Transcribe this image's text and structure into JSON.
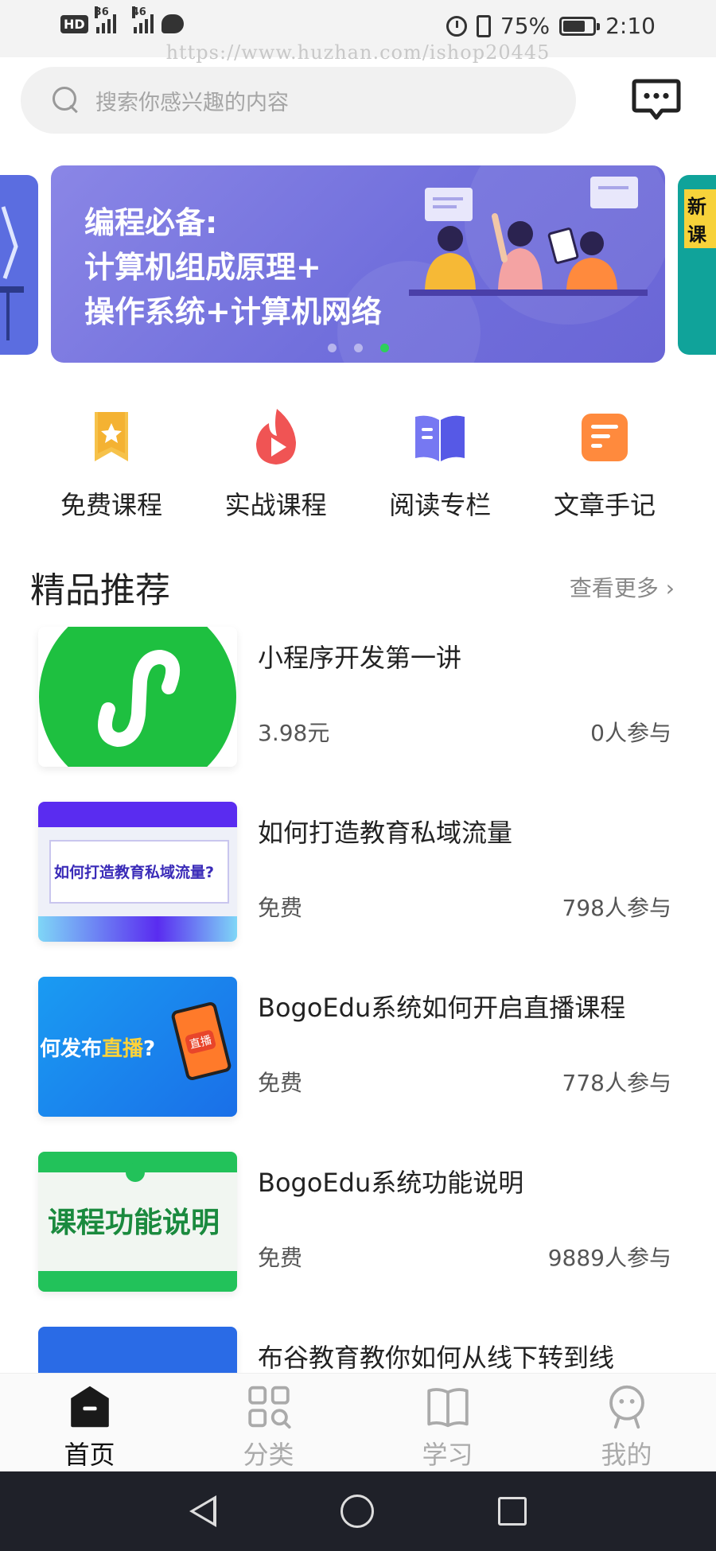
{
  "status_bar": {
    "hd_label": "HD",
    "sim1_label": "36",
    "sim2_label": "46",
    "battery": "75%",
    "battery_level": 0.75,
    "time": "2:10"
  },
  "watermark": "https://www.huzhan.com/ishop20445",
  "search": {
    "placeholder": "搜索你感兴趣的内容",
    "icon": "search-icon"
  },
  "header": {
    "message_icon": "chat-message-icon"
  },
  "banner": {
    "lines": [
      "编程必备:",
      "计算机组成原理+",
      "操作系统+计算机网络"
    ],
    "right_peek_text": "新课",
    "page_count": 3,
    "active_index": 2,
    "colors": {
      "bg": "#7a77e0",
      "active_dot": "#2ecf5a"
    }
  },
  "quick_nav": [
    {
      "label": "免费课程",
      "icon": "bookmark-star-icon",
      "color": "#f5b52b"
    },
    {
      "label": "实战课程",
      "icon": "flame-play-icon",
      "color": "#f05454"
    },
    {
      "label": "阅读专栏",
      "icon": "open-book-icon",
      "color": "#6a6cf0"
    },
    {
      "label": "文章手记",
      "icon": "notes-icon",
      "color": "#ff8a3d"
    }
  ],
  "section": {
    "title": "精品推荐",
    "more": "查看更多"
  },
  "courses": [
    {
      "title": "小程序开发第一讲",
      "price": "3.98元",
      "count": "0人参与",
      "thumb_text": ""
    },
    {
      "title": "如何打造教育私域流量",
      "price": "免费",
      "count": "798人参与",
      "thumb_text": "如何打造教育私域流量?"
    },
    {
      "title": "BogoEdu系统如何开启直播课程",
      "price": "免费",
      "count": "778人参与",
      "thumb_text_a": "何发布",
      "thumb_text_b": "直播",
      "thumb_text_c": "?",
      "badge": "直播"
    },
    {
      "title": "BogoEdu系统功能说明",
      "price": "免费",
      "count": "9889人参与",
      "thumb_text": "课程功能说明"
    },
    {
      "title": "布谷教育教你如何从线下转到线",
      "price": "",
      "count": ""
    }
  ],
  "tabs": [
    {
      "label": "首页",
      "icon": "home-icon",
      "active": true
    },
    {
      "label": "分类",
      "icon": "category-grid-icon",
      "active": false
    },
    {
      "label": "学习",
      "icon": "book-icon",
      "active": false
    },
    {
      "label": "我的",
      "icon": "profile-icon",
      "active": false
    }
  ]
}
